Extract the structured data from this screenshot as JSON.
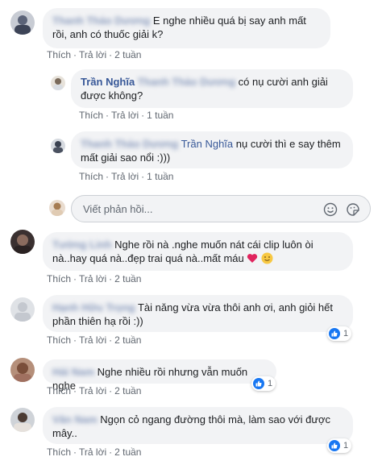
{
  "comments": [
    {
      "author": "Thanh Thảo Dương",
      "text": "E nghe nhiều quá bị say anh mất rồi, anh có thuốc giải k?",
      "like": "Thích",
      "reply": "Trả lời",
      "time": "2 tuần"
    },
    {
      "author": "Trần Nghĩa",
      "tag": "Thanh Thảo Dương",
      "text": "có nụ cười anh giải được không?",
      "like": "Thích",
      "reply": "Trả lời",
      "time": "1 tuần"
    },
    {
      "author": "Thanh Thảo Dương",
      "tag": "Trần Nghĩa",
      "text": "nụ cười thì e say thêm mất giải sao nổi :)))",
      "like": "Thích",
      "reply": "Trả lời",
      "time": "1 tuần"
    },
    {
      "author": "Tường Linh",
      "text": "Nghe rồi nà .nghe muốn nát cái clip luôn òi nà..hay quá nà..đẹp trai quá nà..mất máu",
      "like": "Thích",
      "reply": "Trả lời",
      "time": "2 tuần"
    },
    {
      "author": "Hạnh Hữu Trọng",
      "text": "Tài năng vừa vừa thôi anh ơi, anh giỏi hết phần thiên hạ rồi :))",
      "like": "Thích",
      "reply": "Trả lời",
      "time": "2 tuần",
      "reactions": "1"
    },
    {
      "author": "Hải Nam",
      "text": "Nghe nhiều rồi nhưng vẫn muốn nghe",
      "like": "Thích",
      "reply": "Trả lời",
      "time": "2 tuần",
      "reactions": "1"
    },
    {
      "author": "Văn Nam",
      "text": "Ngọn cỏ ngang đường thôi mà, làm sao với được mây..",
      "like": "Thích",
      "reply": "Trả lời",
      "time": "2 tuần",
      "reactions": "1"
    }
  ],
  "reply_box": {
    "placeholder": "Viết phản hồi..."
  },
  "colors": {
    "link": "#385898",
    "bubble": "#f2f3f5",
    "like": "#1877f2"
  },
  "icons": [
    "smiley-icon",
    "sticker-icon",
    "like-icon",
    "heart-emoji",
    "smile-emoji"
  ]
}
